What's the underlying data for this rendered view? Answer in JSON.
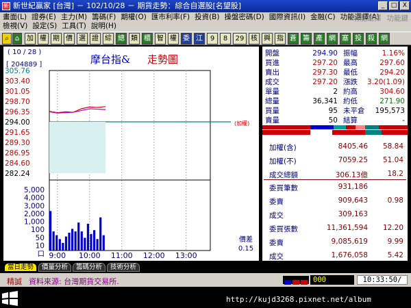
{
  "window": {
    "title": "新世紀贏家 [台灣] － 102/10/28 － 期貨走勢：綜合自選股[名望股]",
    "app_icon": "windows-app-icon",
    "buttons": [
      "_",
      "□",
      "X"
    ]
  },
  "menu": {
    "row1": [
      "畫面(L)",
      "證券(E)",
      "主力(M)",
      "籌碼(F)",
      "期權(O)",
      "匯市利率(F)",
      "投資(B)",
      "操盤密碼(D)",
      "國際資訊(I)",
      "金融(C)",
      "功能選擇(A)"
    ],
    "row2": [
      "檢視(V)",
      "設定(S)",
      "工具(T)",
      "說明(H)"
    ],
    "right": [
      "功能選擇",
      "功能鍵"
    ]
  },
  "toolbar": {
    "items": [
      "加",
      "權",
      "期",
      "價",
      "選",
      "證",
      "綜",
      "總",
      "類",
      "櫃",
      "智",
      "權",
      "委",
      "江",
      "9",
      "8",
      "29",
      "核",
      "興",
      "指",
      "蒼",
      "籌",
      "產",
      "網",
      "塞",
      "投",
      "殺",
      "網"
    ]
  },
  "chart": {
    "date_label": "( 10 / 28 )",
    "volume_label": "[ 204889 ]",
    "title_left": "摩台指&",
    "title_right": "走勢圖",
    "price_ticks": [
      "305.76",
      "303.40",
      "301.05",
      "298.70",
      "296.35",
      "294.00",
      "291.65",
      "289.30",
      "286.95",
      "284.60",
      "282.24"
    ],
    "reference_price": "294.00",
    "reference_note": "(加權)",
    "volume_ticks": [
      "5,000",
      "4,000",
      "3,000",
      "2,000",
      "1,000",
      "100",
      "50",
      "10",
      "口"
    ],
    "time_ticks": [
      "9:00",
      "10:00",
      "11:00",
      "12:00",
      "13:00"
    ],
    "diff_label": "價差",
    "diff_value": "0.15",
    "colors": {
      "price_line": "#cc0000",
      "avg_line": "#cc00cc",
      "volume_bar": "#0000cc",
      "reference_line": "#008080",
      "fill": "#d8f0f0"
    }
  },
  "chart_data": {
    "type": "line",
    "title": "摩台指& 走勢圖",
    "xlabel": "",
    "ylabel": "",
    "xlim": [
      "8:45",
      "13:45"
    ],
    "ylim": [
      282.24,
      305.76
    ],
    "x": [
      "8:45",
      "9:00",
      "9:15",
      "9:30",
      "9:45",
      "10:00",
      "10:15",
      "10:30"
    ],
    "series": [
      {
        "name": "",
        "values": [
          296.4,
          296.1,
          296.3,
          296.2,
          297.0,
          297.4,
          297.3,
          297.5
        ]
      },
      {
        "name": "",
        "values": [
          296.3,
          296.0,
          296.1,
          296.2,
          296.6,
          297.0,
          296.9,
          296.8
        ]
      }
    ],
    "volume": {
      "unit": "口",
      "ylim": [
        0,
        5000
      ],
      "values": [
        3100,
        1500,
        1200,
        900,
        600,
        1100,
        1400,
        1700,
        1500,
        2200,
        1500,
        1000,
        2100,
        1300,
        1600,
        900,
        2600,
        1200
      ]
    },
    "reference_line": 294.0,
    "grid": true
  },
  "quote": {
    "rows": [
      {
        "k1": "開盤",
        "v1": "294.90",
        "k2": "振幅",
        "v2": "1.16%",
        "c1": "#0000cc",
        "c2": "#cc0000"
      },
      {
        "k1": "買進",
        "v1": "297.20",
        "k2": "最高",
        "v2": "297.60",
        "c1": "#cc0000",
        "c2": "#cc0000"
      },
      {
        "k1": "賣出",
        "v1": "297.30",
        "k2": "最低",
        "v2": "294.20",
        "c1": "#cc0000",
        "c2": "#cc0000"
      },
      {
        "k1": "成交",
        "v1": "297.20",
        "k2": "漲跌",
        "v2": "3.20(1.09)",
        "c1": "#cc0000",
        "c2": "#cc0000"
      },
      {
        "k1": "單量",
        "v1": "2",
        "k2": "約高",
        "v2": "304.60",
        "c1": "#000000",
        "c2": "#cc0000"
      },
      {
        "k1": "總量",
        "v1": "36,341",
        "k2": "約低",
        "v2": "271.90",
        "c1": "#000000",
        "c2": "#008000"
      },
      {
        "k1": "買量",
        "v1": "95",
        "k2": "未平倉",
        "v2": "195,573",
        "c1": "#000000",
        "c2": "#000000"
      },
      {
        "k1": "賣量",
        "v1": "50",
        "k2": "結算",
        "v2": "-",
        "c1": "#000000",
        "c2": "#000000"
      }
    ]
  },
  "stats": {
    "index_rows": [
      {
        "label": "加權(含)",
        "value": "8405.46",
        "pct": "58.84"
      },
      {
        "label": "加權(不)",
        "value": "7059.25",
        "pct": "51.04"
      },
      {
        "label": "成交總額",
        "value": "306.13億",
        "pct": "18.2"
      }
    ],
    "order_rows": [
      {
        "label": "委買筆數",
        "value": "931,186",
        "pct": ""
      },
      {
        "label": "委賣",
        "value": "909,643",
        "pct": "0.98"
      },
      {
        "label": "成交",
        "value": "309,163",
        "pct": ""
      },
      {
        "label": "委買張數",
        "value": "11,361,594",
        "pct": "12.20"
      },
      {
        "label": "委賣",
        "value": "9,085,619",
        "pct": "9.99"
      },
      {
        "label": "成交",
        "value": "1,676,058",
        "pct": "5.42"
      }
    ]
  },
  "tabs": [
    "當日走勢",
    "價量分析",
    "籌碼分析",
    "技術分析"
  ],
  "status": {
    "label": "精誠",
    "source": "資料來源: 台灣期貨交易所.",
    "count": "000",
    "time": "10:33:50/"
  },
  "taskbar": {
    "url": "http://kujd3268.pixnet.net/album"
  }
}
